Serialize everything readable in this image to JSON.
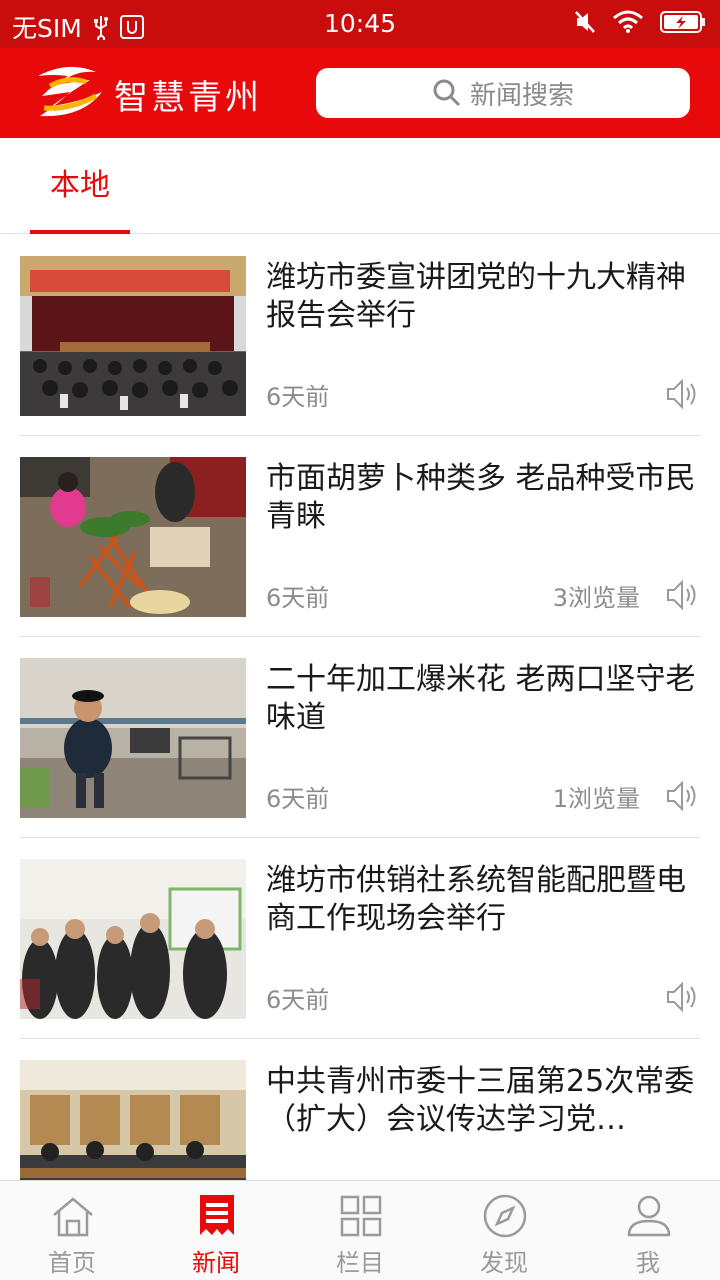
{
  "status_bar": {
    "carrier": "无SIM",
    "time": "10:45"
  },
  "header": {
    "app_title": "智慧青州",
    "search_placeholder": "新闻搜索"
  },
  "tabs": [
    {
      "label": "本地",
      "active": true
    }
  ],
  "news": [
    {
      "title": "潍坊市委宣讲团党的十九大精神报告会举行",
      "time": "6天前",
      "views": ""
    },
    {
      "title": "市面胡萝卜种类多 老品种受市民青睐",
      "time": "6天前",
      "views": "3浏览量"
    },
    {
      "title": "二十年加工爆米花 老两口坚守老味道",
      "time": "6天前",
      "views": "1浏览量"
    },
    {
      "title": "潍坊市供销社系统智能配肥暨电商工作现场会举行",
      "time": "6天前",
      "views": ""
    },
    {
      "title": "中共青州市委十三届第25次常委（扩大）会议传达学习党…",
      "time": "",
      "views": ""
    }
  ],
  "bottom_nav": [
    {
      "label": "首页",
      "icon": "home-icon"
    },
    {
      "label": "新闻",
      "icon": "news-icon",
      "active": true
    },
    {
      "label": "栏目",
      "icon": "grid-icon"
    },
    {
      "label": "发现",
      "icon": "compass-icon"
    },
    {
      "label": "我",
      "icon": "user-icon"
    }
  ],
  "colors": {
    "brand_red": "#e8090b",
    "status_bar": "#c90d0d",
    "text_primary": "#1a1a1a",
    "text_secondary": "#8c8c8c"
  }
}
